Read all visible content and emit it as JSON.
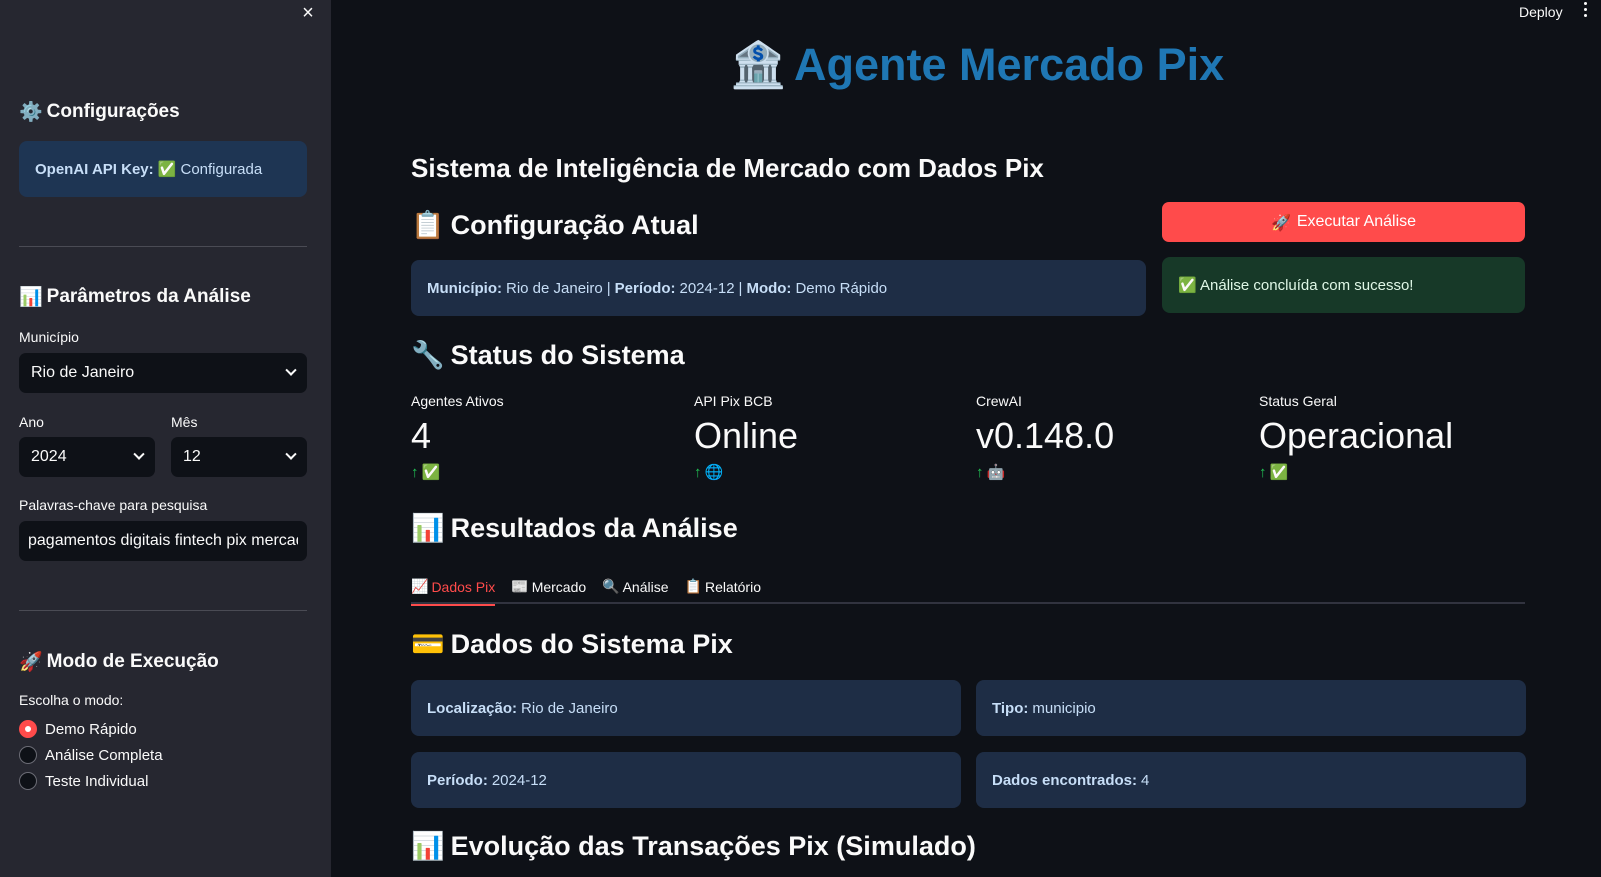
{
  "sidebar": {
    "config_heading": "Configurações",
    "config_icon": "⚙️",
    "api_key_label": "OpenAI API Key:",
    "api_key_status": "✅ Configurada",
    "params_heading": "Parâmetros da Análise",
    "params_icon": "📊",
    "municipio_label": "Município",
    "municipio_value": "Rio de Janeiro",
    "ano_label": "Ano",
    "ano_value": "2024",
    "mes_label": "Mês",
    "mes_value": "12",
    "keywords_label": "Palavras-chave para pesquisa",
    "keywords_value": "pagamentos digitais fintech pix mercado",
    "mode_heading": "Modo de Execução",
    "mode_icon": "🚀",
    "mode_prompt": "Escolha o modo:",
    "modes": [
      "Demo Rápido",
      "Análise Completa",
      "Teste Individual"
    ],
    "selected_mode": "Demo Rápido"
  },
  "header": {
    "deploy_label": "Deploy",
    "title": "Agente Mercado Pix",
    "title_icon": "🏦"
  },
  "main": {
    "subtitle": "Sistema de Inteligência de Mercado com Dados Pix",
    "current_config_heading": "Configuração Atual",
    "current_config_icon": "📋",
    "current_config": {
      "municipio_key": "Município:",
      "municipio_val": "Rio de Janeiro",
      "sep1": "|",
      "periodo_key": "Período:",
      "periodo_val": "2024-12",
      "sep2": "|",
      "modo_key": "Modo:",
      "modo_val": "Demo Rápido"
    },
    "run_button": "Executar Análise",
    "run_icon": "🚀",
    "success_message": "✅ Análise concluída com sucesso!",
    "status_heading": "Status do Sistema",
    "status_icon": "🔧",
    "metrics": [
      {
        "label": "Agentes Ativos",
        "value": "4",
        "delta": "✅"
      },
      {
        "label": "API Pix BCB",
        "value": "Online",
        "delta": "🌐"
      },
      {
        "label": "CrewAI",
        "value": "v0.148.0",
        "delta": "🤖"
      },
      {
        "label": "Status Geral",
        "value": "Operacional",
        "delta": "✅"
      }
    ],
    "results_heading": "Resultados da Análise",
    "results_icon": "📊",
    "tabs": [
      {
        "icon": "📈",
        "label": "Dados Pix"
      },
      {
        "icon": "📰",
        "label": "Mercado"
      },
      {
        "icon": "🔍",
        "label": "Análise"
      },
      {
        "icon": "📋",
        "label": "Relatório"
      }
    ],
    "active_tab": "Dados Pix",
    "pix_heading": "Dados do Sistema Pix",
    "pix_icon": "💳",
    "pix_cards": {
      "localizacao_key": "Localização:",
      "localizacao_val": "Rio de Janeiro",
      "tipo_key": "Tipo:",
      "tipo_val": "municipio",
      "periodo_key": "Período:",
      "periodo_val": "2024-12",
      "dados_key": "Dados encontrados:",
      "dados_val": "4"
    },
    "evolution_heading": "Evolução das Transações Pix (Simulado)",
    "evolution_icon": "📊"
  },
  "colors": {
    "accent": "#ff4b4b",
    "title_blue": "#1f77b4",
    "delta_green": "#21c354"
  }
}
